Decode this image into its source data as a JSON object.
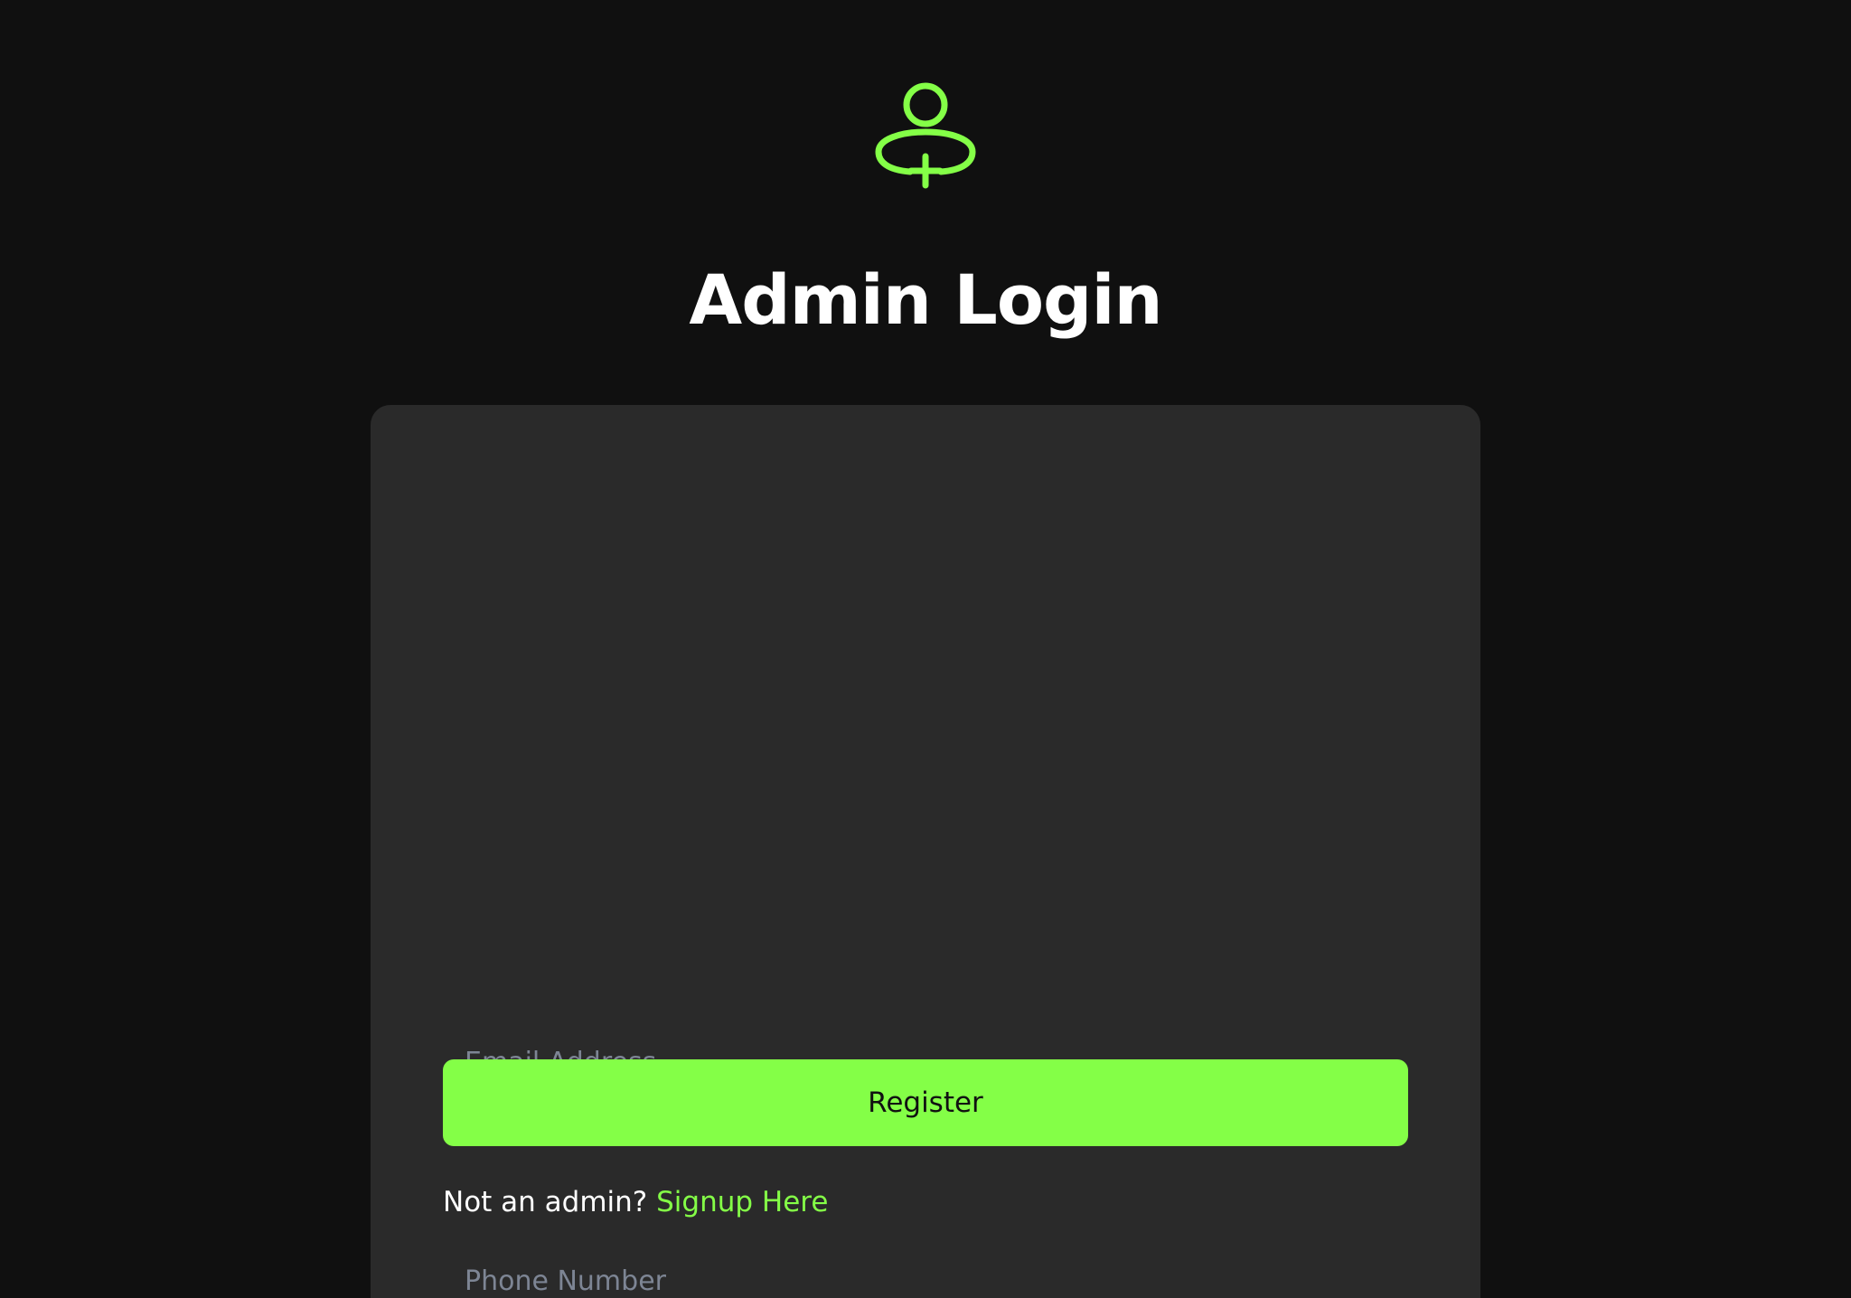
{
  "header": {
    "icon": "user-add-icon",
    "title": "Admin Login"
  },
  "form": {
    "email_placeholder": "Email Address",
    "email_value": "",
    "phone_placeholder": "Phone Number",
    "phone_value": "",
    "submit_label": "Register"
  },
  "footer": {
    "prompt": "Not an admin?",
    "link_label": "Signup Here"
  },
  "colors": {
    "background": "#101010",
    "card": "#2a2a2a",
    "accent": "#84ff47",
    "text": "#ffffff",
    "placeholder": "#7d8594"
  }
}
